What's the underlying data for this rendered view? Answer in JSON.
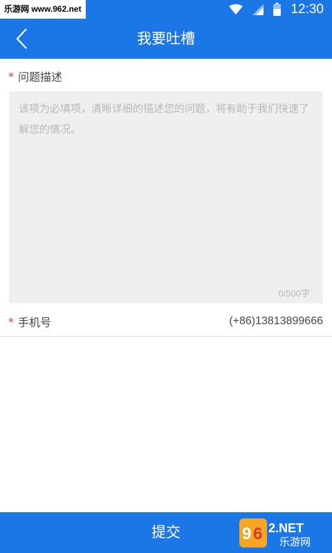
{
  "status_bar": {
    "watermark": "乐游网 www.962.net",
    "time": "12:30",
    "icons": [
      "wifi-icon",
      "signal-icon",
      "battery-icon"
    ]
  },
  "header": {
    "title": "我要吐槽",
    "back_icon": "chevron-left-icon"
  },
  "description": {
    "required_mark": "*",
    "label": "问题描述",
    "placeholder": "该项为必填项，清晰详细的描述您的问题，将有助于我们快速了解您的情况。",
    "counter": "0/500字"
  },
  "phone": {
    "required_mark": "*",
    "label": "手机号",
    "value": "(+86)13813899666"
  },
  "submit": {
    "label": "提交"
  },
  "badge": {
    "top_text": "962.NET",
    "bottom_text": "乐游网"
  },
  "colors": {
    "primary": "#1c77e6",
    "required": "#e0342b",
    "input_bg": "#efefef",
    "placeholder": "#b8b8b8"
  }
}
